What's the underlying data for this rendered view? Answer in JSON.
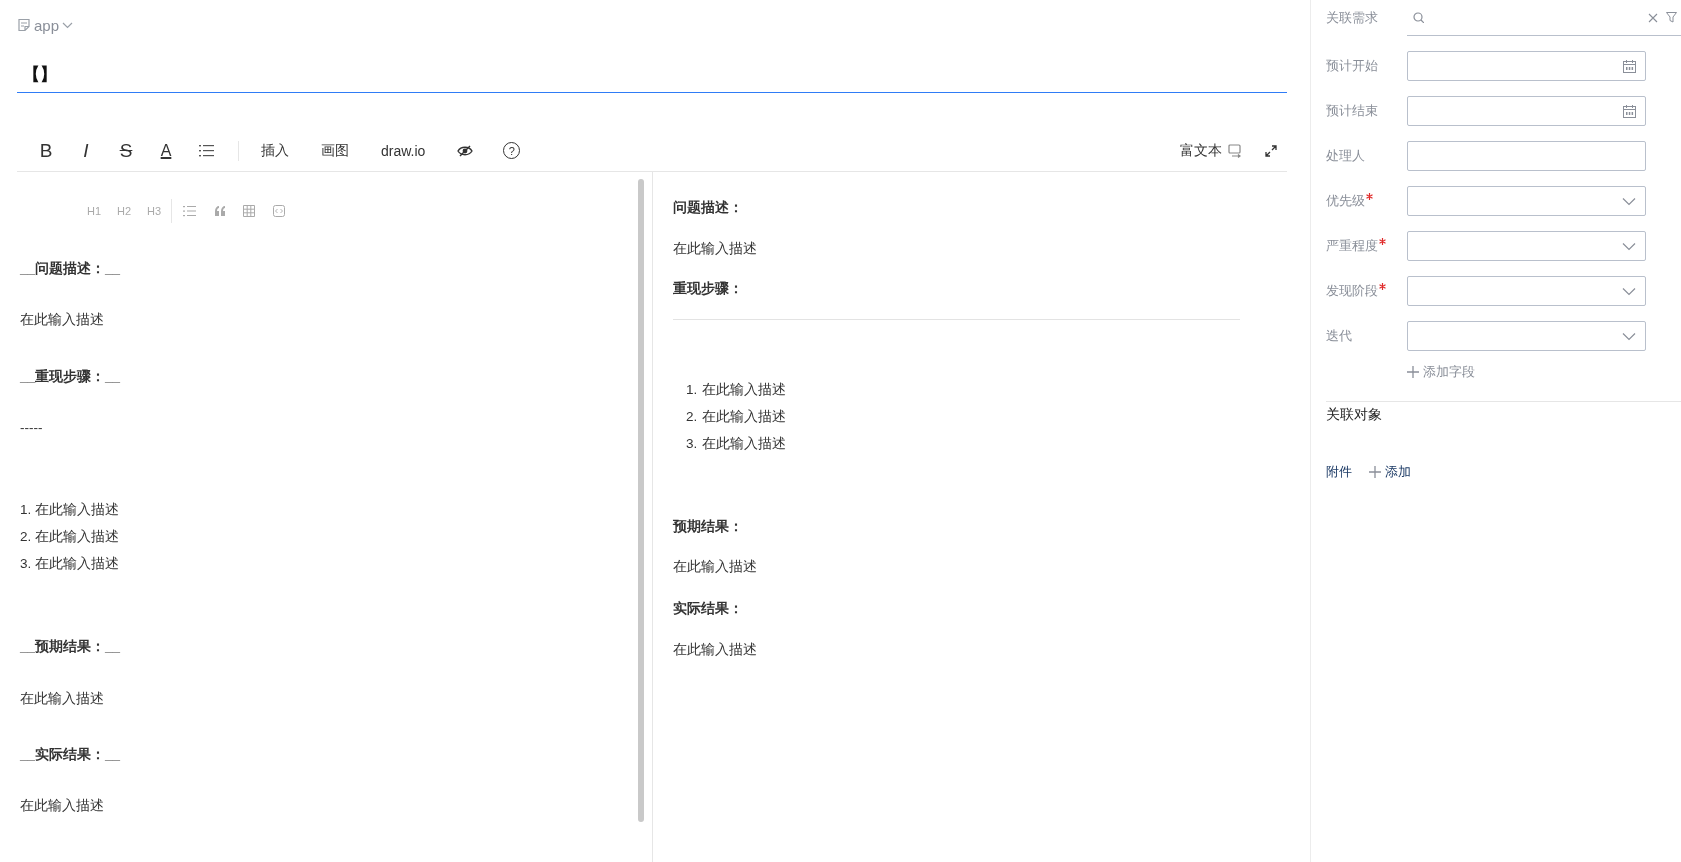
{
  "breadcrumb": {
    "label": "app"
  },
  "title": {
    "value": "【】"
  },
  "toolbar": {
    "format_buttons": [
      {
        "kind": "bold",
        "label": "B"
      },
      {
        "kind": "italic",
        "label": "I"
      },
      {
        "kind": "strike",
        "label": "S"
      },
      {
        "kind": "color",
        "label": "A"
      }
    ],
    "text_buttons": [
      "插入",
      "画图",
      "draw.io"
    ],
    "help": "?",
    "mode_label": "富文本"
  },
  "markdown_toolbar": {
    "headings": [
      "H1",
      "H2",
      "H3"
    ]
  },
  "editor": {
    "lines": [
      {
        "kind": "strong",
        "text": "__问题描述：__"
      },
      {
        "kind": "text",
        "text": "在此输入描述"
      },
      {
        "kind": "strong",
        "text": "__重现步骤：__"
      },
      {
        "kind": "text",
        "text": "-----"
      },
      {
        "kind": "text",
        "text": "1. 在此输入描述"
      },
      {
        "kind": "text",
        "text": "2. 在此输入描述"
      },
      {
        "kind": "text",
        "text": "3. 在此输入描述"
      },
      {
        "kind": "strong",
        "text": "__预期结果：__"
      },
      {
        "kind": "text",
        "text": "在此输入描述"
      },
      {
        "kind": "strong",
        "text": "__实际结果：__"
      },
      {
        "kind": "text",
        "text": "在此输入描述"
      }
    ]
  },
  "preview": {
    "blocks": [
      {
        "kind": "heading",
        "text": "问题描述："
      },
      {
        "kind": "text",
        "text": "在此输入描述"
      },
      {
        "kind": "heading",
        "text": "重现步骤："
      },
      {
        "kind": "rule"
      },
      {
        "kind": "list",
        "items": [
          {
            "number": "1.",
            "text": "在此输入描述"
          },
          {
            "number": "2.",
            "text": "在此输入描述"
          },
          {
            "number": "3.",
            "text": "在此输入描述"
          }
        ]
      },
      {
        "kind": "heading",
        "text": "预期结果："
      },
      {
        "kind": "text",
        "text": "在此输入描述"
      },
      {
        "kind": "heading",
        "text": "实际结果："
      },
      {
        "kind": "text",
        "text": "在此输入描述"
      }
    ]
  },
  "side_panel": {
    "fields": [
      {
        "label": "关联需求",
        "kind": "search",
        "required": false
      },
      {
        "label": "预计开始",
        "kind": "date",
        "required": false
      },
      {
        "label": "预计结束",
        "kind": "date",
        "required": false
      },
      {
        "label": "处理人",
        "kind": "text",
        "required": false
      },
      {
        "label": "优先级",
        "kind": "select",
        "required": true
      },
      {
        "label": "严重程度",
        "kind": "select",
        "required": true
      },
      {
        "label": "发现阶段",
        "kind": "select",
        "required": true
      },
      {
        "label": "迭代",
        "kind": "select",
        "required": false
      }
    ],
    "add_field": "添加字段",
    "related_section": "关联对象",
    "attachments": {
      "label": "附件",
      "add": "添加"
    }
  }
}
